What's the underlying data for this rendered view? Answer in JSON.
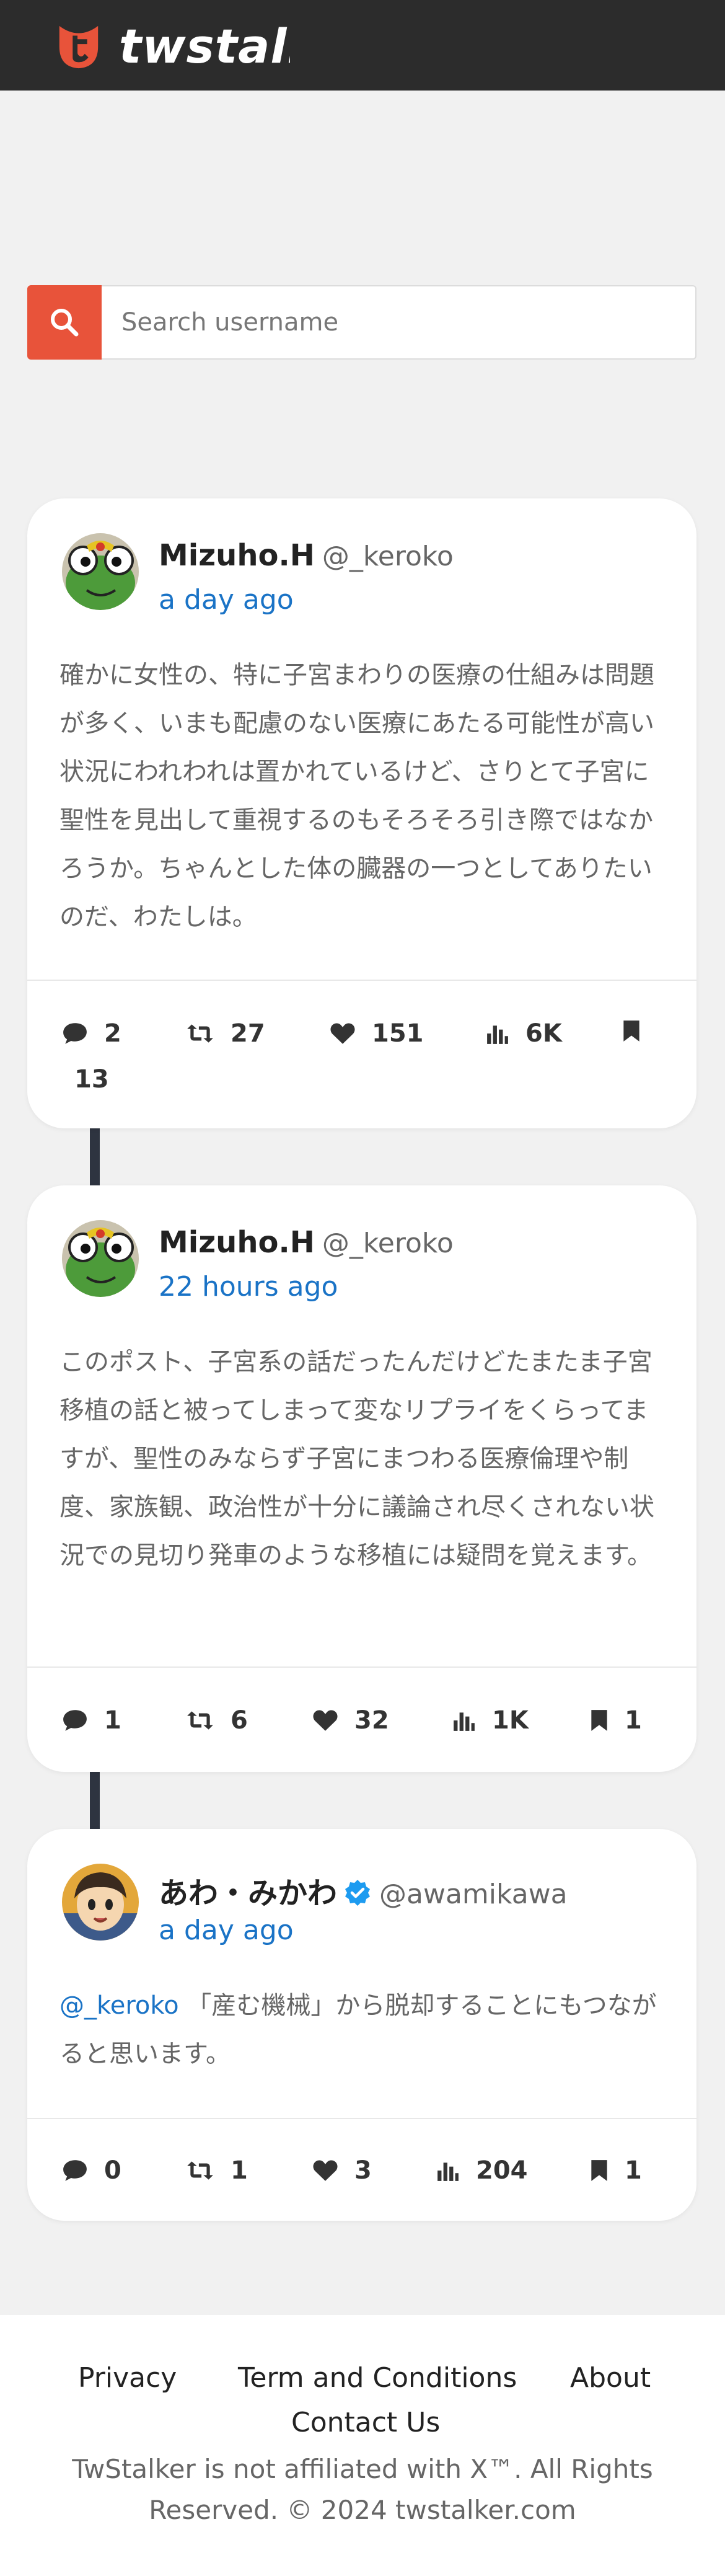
{
  "brand": {
    "name": "twstalker",
    "accent": "#e8533a"
  },
  "search": {
    "placeholder": "Search username"
  },
  "tweets": [
    {
      "name": "Mizuho.H",
      "handle": "@_keroko",
      "time": "a day ago",
      "verified": false,
      "text": "確かに女性の、特に子宮まわりの医療の仕組みは問題が多く、いまも配慮のない医療にあたる可能性が高い状況にわれわれは置かれているけど、さりとて子宮に聖性を見出して重視するのもそろそろ引き際ではなかろうか。ちゃんとした体の臓器の一つとしてありたいのだ、わたしは。",
      "stats": {
        "replies": "2",
        "retweets": "27",
        "likes": "151",
        "views": "6K",
        "bookmarks": "13"
      }
    },
    {
      "name": "Mizuho.H",
      "handle": "@_keroko",
      "time": "22 hours ago",
      "verified": false,
      "text": "このポスト、子宮系の話だったんだけどたまたま子宮移植の話と被ってしまって変なリプライをくらってますが、聖性のみならず子宮にまつわる医療倫理や制度、家族観、政治性が十分に議論され尽くされない状況での見切り発車のような移植には疑問を覚えます。",
      "stats": {
        "replies": "1",
        "retweets": "6",
        "likes": "32",
        "views": "1K",
        "bookmarks": "1"
      }
    },
    {
      "name": "あわ・みかわ",
      "handle": "@awamikawa",
      "time": "a day ago",
      "verified": true,
      "mention": "@_keroko",
      "text": "「産む機械」から脱却することにもつながると思います。",
      "stats": {
        "replies": "0",
        "retweets": "1",
        "likes": "3",
        "views": "204",
        "bookmarks": "1"
      }
    }
  ],
  "footer": {
    "privacy": "Privacy",
    "terms": "Term and Conditions",
    "about": "About",
    "contact": "Contact Us",
    "note_line1": "TwStalker is not affiliated with X™. All Rights",
    "note_line2": "Reserved. © 2024 twstalker.com"
  }
}
